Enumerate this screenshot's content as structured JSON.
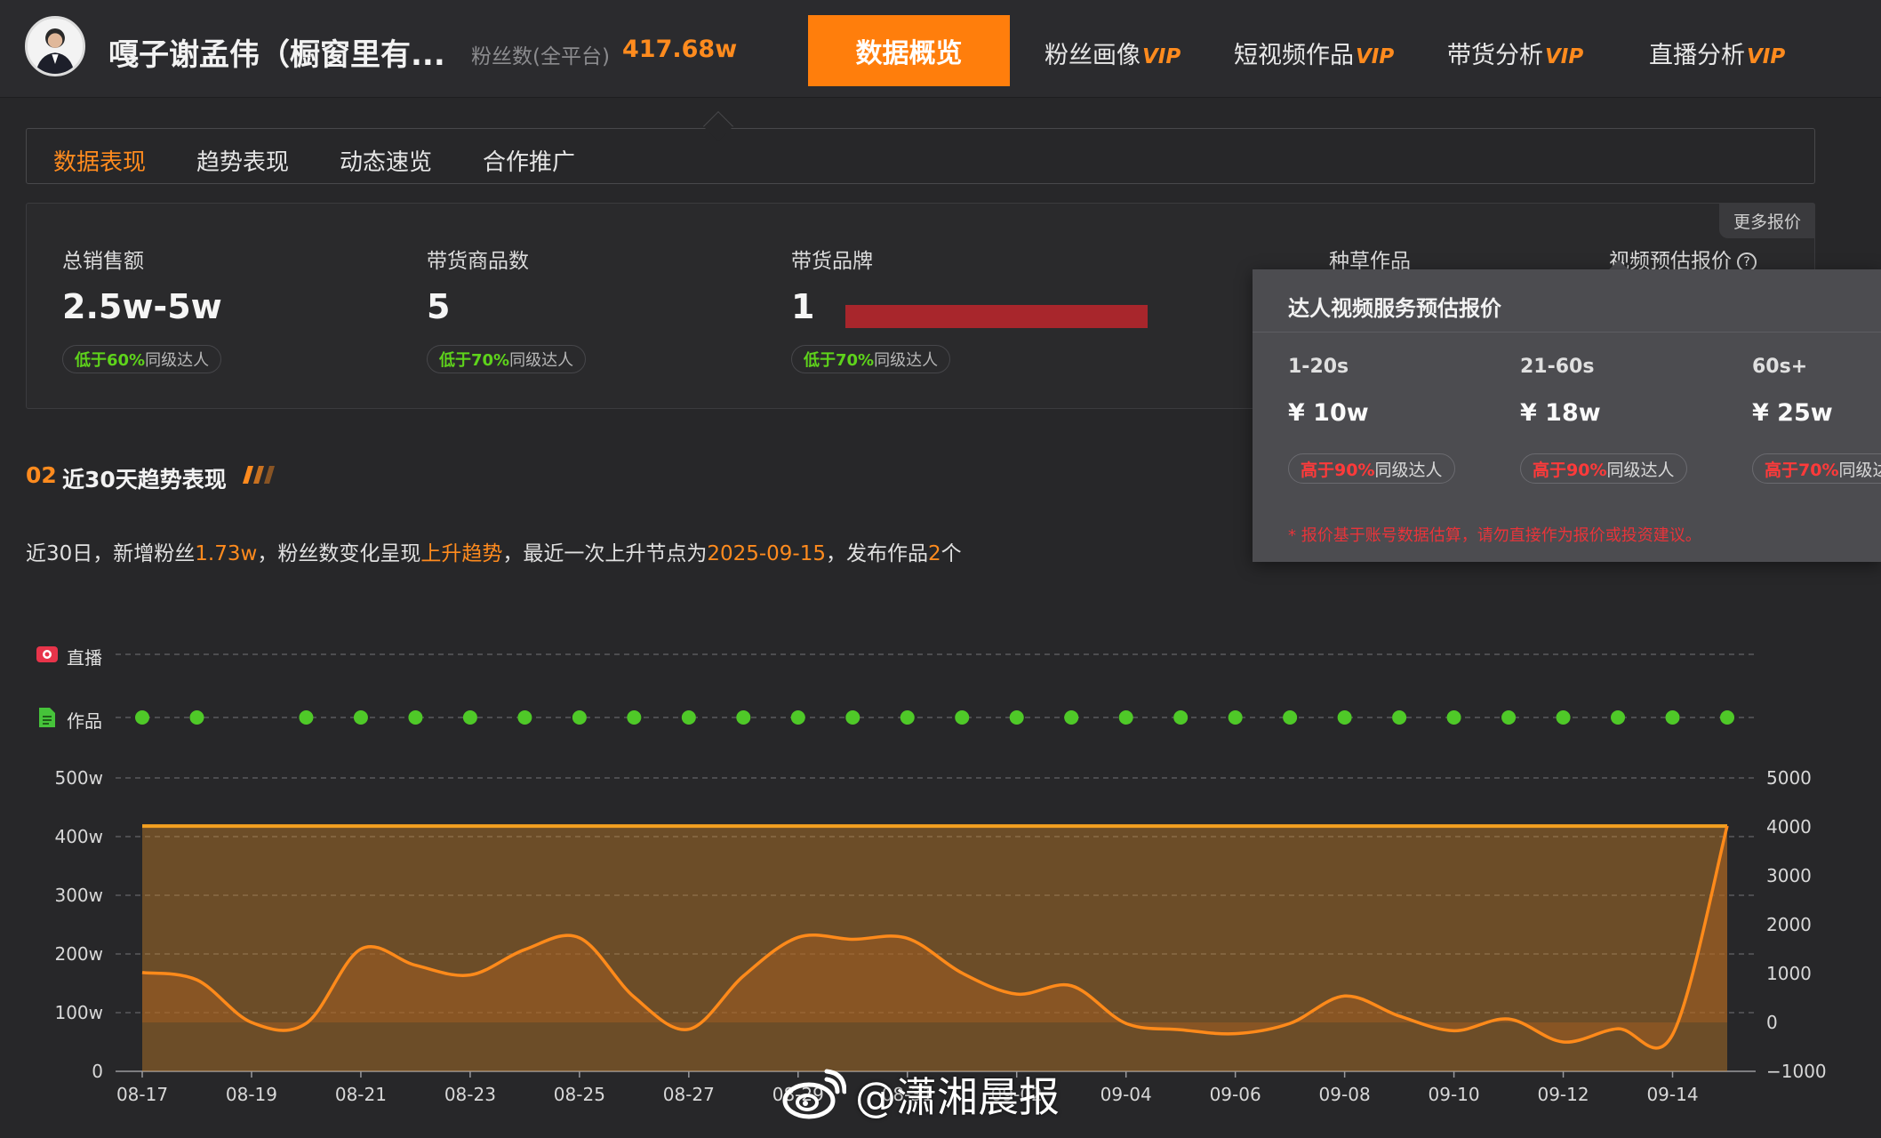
{
  "header": {
    "account_name": "嘎子谢孟伟（橱窗里有...",
    "fans_label": "粉丝数(全平台)",
    "fans_value": "417.68w",
    "nav": [
      {
        "label": "数据概览",
        "vip": ""
      },
      {
        "label": "粉丝画像",
        "vip": "VIP"
      },
      {
        "label": "短视频作品",
        "vip": "VIP"
      },
      {
        "label": "带货分析",
        "vip": "VIP"
      },
      {
        "label": "直播分析",
        "vip": "VIP"
      }
    ]
  },
  "subtabs": [
    "数据表现",
    "趋势表现",
    "动态速览",
    "合作推广"
  ],
  "metrics": {
    "total_sales": {
      "label": "总销售额",
      "value": "2.5w-5w",
      "badge_prefix": "低于60%",
      "badge_suffix": "同级达人"
    },
    "product_count": {
      "label": "带货商品数",
      "value": "5",
      "badge_prefix": "低于70%",
      "badge_suffix": "同级达人"
    },
    "brands": {
      "label": "带货品牌",
      "value": "1",
      "badge_prefix": "低于70%",
      "badge_suffix": "同级达人"
    },
    "seeding": {
      "label": "种草作品"
    },
    "video_price": {
      "label": "视频预估报价"
    },
    "more_price": "更多报价"
  },
  "price_popover": {
    "title": "达人视频服务预估报价",
    "tiers": [
      {
        "duration": "1-20s",
        "price": "¥ 10w",
        "badge_prefix": "高于90%",
        "badge_suffix": "同级达人"
      },
      {
        "duration": "21-60s",
        "price": "¥ 18w",
        "badge_prefix": "高于90%",
        "badge_suffix": "同级达人"
      },
      {
        "duration": "60s+",
        "price": "¥ 25w",
        "badge_prefix": "高于70%",
        "badge_suffix": "同级达人"
      }
    ],
    "note": "* 报价基于账号数据估算，请勿直接作为报价或投资建议。"
  },
  "trend": {
    "section_num": "02",
    "section_title": "近30天趋势表现",
    "summary": {
      "p1": "近30日，新增粉丝",
      "fans_gain": "1.73w",
      "p2": "，粉丝数变化呈现",
      "trend": "上升趋势",
      "p3": "，最近一次上升节点为",
      "date": "2025-09-15",
      "p4": "，发布作品",
      "works": "2",
      "p5": "个"
    },
    "row_live": "直播",
    "row_works": "作品"
  },
  "chart_data": {
    "type": "line",
    "x": [
      "08-17",
      "08-18",
      "08-19",
      "08-20",
      "08-21",
      "08-22",
      "08-23",
      "08-24",
      "08-25",
      "08-26",
      "08-27",
      "08-28",
      "08-29",
      "08-30",
      "08-31",
      "09-01",
      "09-02",
      "09-03",
      "09-04",
      "09-05",
      "09-06",
      "09-07",
      "09-08",
      "09-09",
      "09-10",
      "09-11",
      "09-12",
      "09-13",
      "09-14",
      "09-15"
    ],
    "xticks": [
      "08-17",
      "08-19",
      "08-21",
      "08-23",
      "08-25",
      "08-27",
      "08-29",
      "08-31",
      "09-02",
      "09-04",
      "09-06",
      "09-08",
      "09-10",
      "09-12",
      "09-14"
    ],
    "left_ticks": [
      "0",
      "100w",
      "200w",
      "300w",
      "400w",
      "500w"
    ],
    "right_ticks": [
      "−1000",
      "0",
      "1000",
      "2000",
      "3000",
      "4000",
      "5000"
    ],
    "ylim_left": [
      0,
      500
    ],
    "ylim_right": [
      -1000,
      5000
    ],
    "series": [
      {
        "axis": "left",
        "color": "#f4a020",
        "values": [
          418,
          418,
          418,
          418,
          418,
          418,
          418,
          418,
          418,
          418,
          418,
          418,
          418,
          418,
          418,
          418,
          418,
          418,
          418,
          418,
          418,
          418,
          418,
          418,
          418,
          418,
          418,
          418,
          418,
          418
        ]
      },
      {
        "axis": "right",
        "color": "#ff8a1a",
        "values": [
          1020,
          870,
          0,
          -20,
          1500,
          1170,
          970,
          1490,
          1730,
          520,
          -140,
          950,
          1740,
          1700,
          1720,
          1010,
          580,
          750,
          -20,
          -150,
          -230,
          -20,
          540,
          130,
          -170,
          70,
          -400,
          -130,
          -250,
          4020
        ]
      }
    ],
    "works_markers": [
      "08-17",
      "08-18",
      "08-20",
      "08-21",
      "08-22",
      "08-23",
      "08-24",
      "08-25",
      "08-26",
      "08-27",
      "08-28",
      "08-29",
      "08-30",
      "08-31",
      "09-01",
      "09-02",
      "09-03",
      "09-04",
      "09-05",
      "09-06",
      "09-07",
      "09-08",
      "09-09",
      "09-10",
      "09-11",
      "09-12",
      "09-13",
      "09-14",
      "09-15"
    ]
  },
  "colors": {
    "accent": "#ff7e0c",
    "positive": "#5ed31b",
    "negative": "#ff3a3a",
    "background": "#272729"
  },
  "watermark": "@潇湘晨报"
}
